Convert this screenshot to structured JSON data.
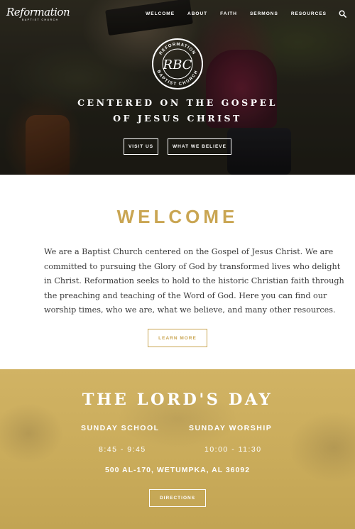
{
  "header": {
    "logo_script": "Reformation",
    "logo_sub": "BAPTIST CHURCH",
    "nav": [
      {
        "label": "WELCOME"
      },
      {
        "label": "ABOUT"
      },
      {
        "label": "FAITH"
      },
      {
        "label": "SERMONS"
      },
      {
        "label": "RESOURCES"
      }
    ],
    "search_icon": "search-icon"
  },
  "hero": {
    "emblem": {
      "monogram": "RBC",
      "arc_top": "REFORMATION",
      "arc_bottom": "BAPTIST CHURCH"
    },
    "title_lines": [
      "CENTERED ON THE GOSPEL",
      "OF JESUS CHRIST"
    ],
    "buttons": {
      "visit": "VISIT US",
      "believe": "WHAT WE BELIEVE"
    }
  },
  "welcome": {
    "title": "WELCOME",
    "text_lines": [
      "We are a Baptist Church centered on the Gospel of Jesus Christ. We are",
      "committed to pursuing the Glory of God by transformed lives who delight",
      "in Christ. Reformation seeks to hold to the historic Christian faith through",
      "the preaching and teaching of the Word of God. Here you can find our",
      "worship times, who we are, what we believe, and many other resources."
    ],
    "button": "LEARN MORE"
  },
  "lords_day": {
    "title": "THE LORD'S DAY",
    "services": [
      {
        "label": "SUNDAY SCHOOL",
        "time": "8:45 - 9:45"
      },
      {
        "label": "SUNDAY WORSHIP",
        "time": "10:00 - 11:30"
      }
    ],
    "address": "500 AL-170, WETUMPKA, AL 36092",
    "button": "DIRECTIONS"
  },
  "colors": {
    "gold": "#c9a552",
    "gold_band": "#c9ab5a",
    "text": "#3b3b3b"
  }
}
